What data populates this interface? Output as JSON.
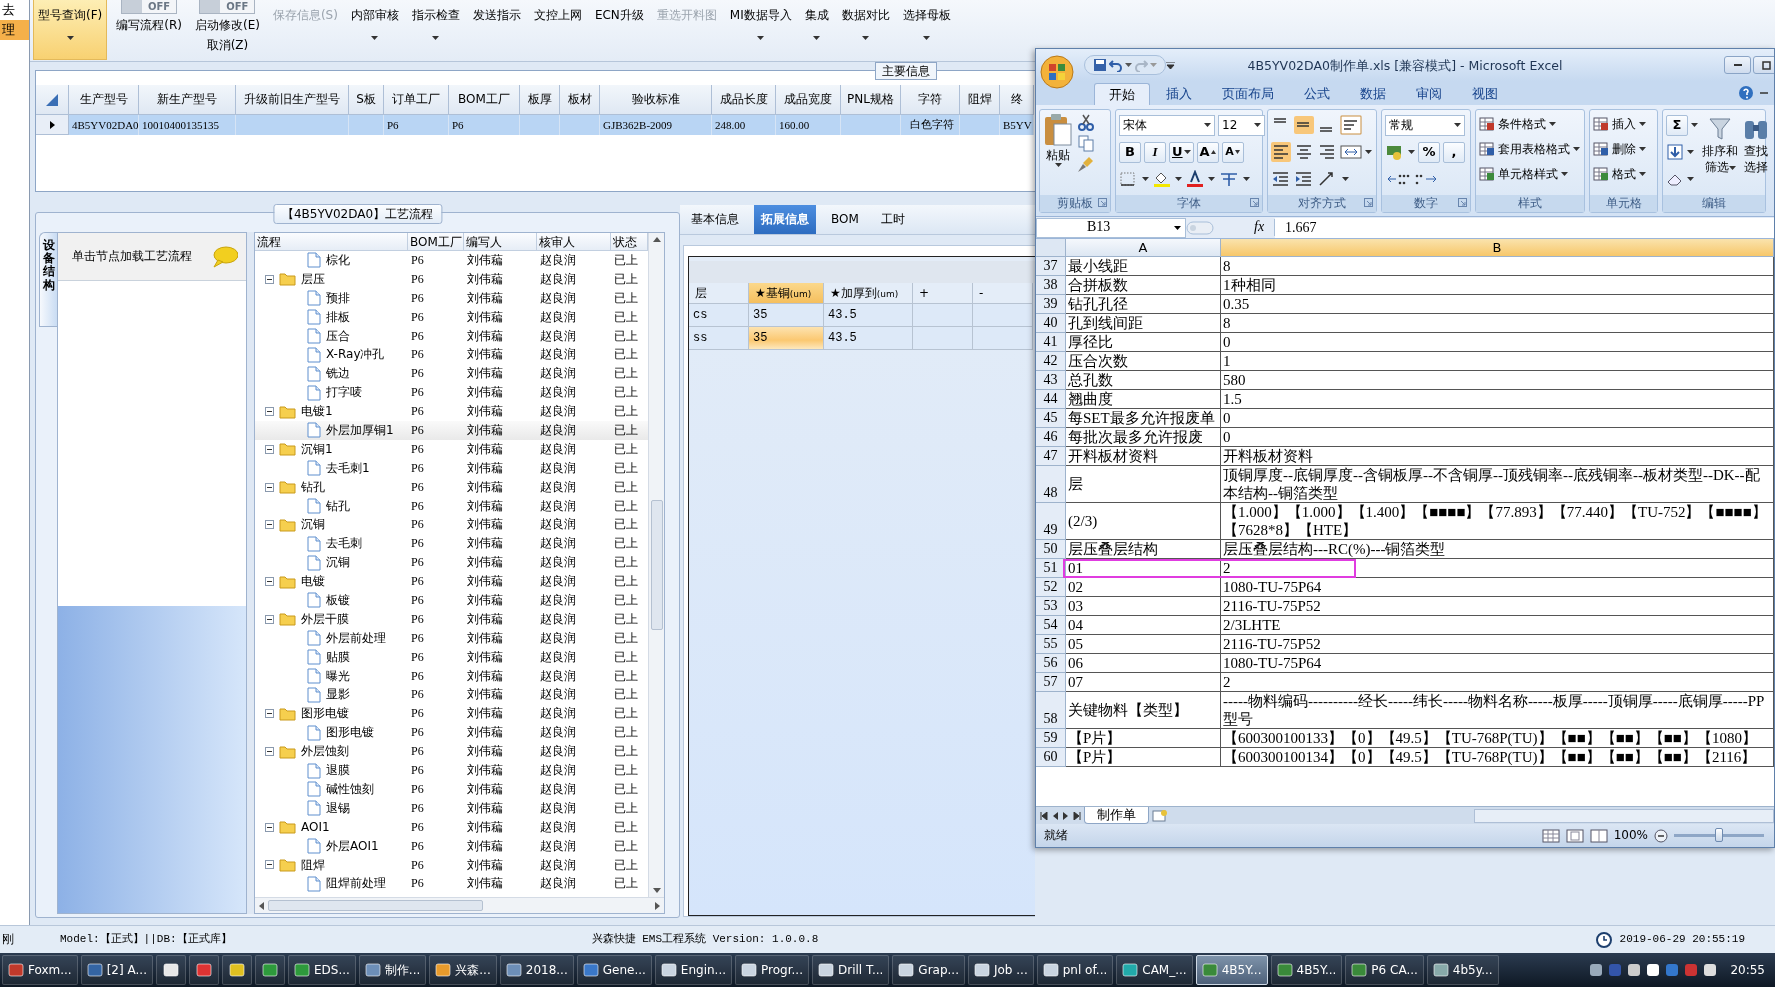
{
  "left_strip": [
    {
      "label": "去",
      "selected": false
    },
    {
      "label": "理",
      "selected": true
    }
  ],
  "toolbar": [
    {
      "kind": "button",
      "label": "型号查询(F)",
      "selected": true,
      "disabled": false,
      "dropdown": true
    },
    {
      "kind": "toggle",
      "state_text": "OFF",
      "on": false,
      "label": "编写流程(R)"
    },
    {
      "kind": "toggle",
      "state_text": "OFF",
      "on": false,
      "label": "启动修改(E)",
      "sublabel": "取消(Z)"
    },
    {
      "kind": "button",
      "label": "保存信息(S)",
      "selected": false,
      "disabled": true,
      "dropdown": false
    },
    {
      "kind": "button",
      "label": "内部审核",
      "selected": false,
      "disabled": false,
      "dropdown": true
    },
    {
      "kind": "button",
      "label": "指示检查",
      "selected": false,
      "disabled": false,
      "dropdown": true
    },
    {
      "kind": "button",
      "label": "发送指示",
      "selected": false,
      "disabled": false,
      "dropdown": false
    },
    {
      "kind": "button",
      "label": "文控上网",
      "selected": false,
      "disabled": false,
      "dropdown": false
    },
    {
      "kind": "button",
      "label": "ECN升级",
      "selected": false,
      "disabled": false,
      "dropdown": false
    },
    {
      "kind": "button",
      "label": "重选开料图",
      "selected": false,
      "disabled": true,
      "dropdown": false
    },
    {
      "kind": "button",
      "label": "MI数据导入",
      "selected": false,
      "disabled": false,
      "dropdown": true
    },
    {
      "kind": "button",
      "label": "集成",
      "selected": false,
      "disabled": false,
      "dropdown": true
    },
    {
      "kind": "button",
      "label": "数据对比",
      "selected": false,
      "disabled": false,
      "dropdown": true
    },
    {
      "kind": "button",
      "label": "选择母板",
      "selected": false,
      "disabled": false,
      "dropdown": true
    }
  ],
  "main_info": {
    "title": "主要信息",
    "columns": [
      "生产型号",
      "新生产型号",
      "升级前旧生产型号",
      "S板",
      "订单工厂",
      "BOM工厂",
      "板厚",
      "板材",
      "验收标准",
      "成品长度",
      "成品宽度",
      "PNL规格",
      "字符",
      "阻焊",
      "终"
    ],
    "rows": [
      {
        "selected": true,
        "cells": [
          "4B5YV02DA0",
          "10010400135135",
          null,
          null,
          "P6",
          "P6",
          null,
          null,
          "GJB362B-2009",
          "248.00",
          "160.00",
          null,
          "白色字符",
          null,
          "B5YV"
        ]
      }
    ]
  },
  "flow": {
    "title": "【4B5YV02DA0】工艺流程",
    "side_tab": "设备结构",
    "hint": "单击节点加载工艺流程",
    "columns": [
      "流程",
      "BOM工厂",
      "编写人",
      "核审人",
      "状态"
    ],
    "nodes": [
      {
        "children": [
          {
            "label": "棕化",
            "bom": "P6",
            "writer": "刘伟藊",
            "reviewer": "赵良润",
            "status": "已上",
            "selected": false
          }
        ]
      },
      {
        "label": "层压",
        "bom": "P6",
        "writer": "刘伟藊",
        "reviewer": "赵良润",
        "status": "已上",
        "selected": false,
        "expanded": true,
        "children": [
          {
            "label": "预排",
            "bom": "P6",
            "writer": "刘伟藊",
            "reviewer": "赵良润",
            "status": "已上",
            "selected": false
          },
          {
            "label": "排板",
            "bom": "P6",
            "writer": "刘伟藊",
            "reviewer": "赵良润",
            "status": "已上",
            "selected": false
          },
          {
            "label": "压合",
            "bom": "P6",
            "writer": "刘伟藊",
            "reviewer": "赵良润",
            "status": "已上",
            "selected": false
          },
          {
            "label": "X-Ray冲孔",
            "bom": "P6",
            "writer": "刘伟藊",
            "reviewer": "赵良润",
            "status": "已上",
            "selected": false
          },
          {
            "label": "铣边",
            "bom": "P6",
            "writer": "刘伟藊",
            "reviewer": "赵良润",
            "status": "已上",
            "selected": false
          },
          {
            "label": "打字唛",
            "bom": "P6",
            "writer": "刘伟藊",
            "reviewer": "赵良润",
            "status": "已上",
            "selected": false
          }
        ]
      },
      {
        "label": "电镀1",
        "bom": "P6",
        "writer": "刘伟藊",
        "reviewer": "赵良润",
        "status": "已上",
        "selected": false,
        "expanded": true,
        "children": [
          {
            "label": "外层加厚铜1",
            "bom": "P6",
            "writer": "刘伟藊",
            "reviewer": "赵良润",
            "status": "已上",
            "selected": true
          }
        ]
      },
      {
        "label": "沉铜1",
        "bom": "P6",
        "writer": "刘伟藊",
        "reviewer": "赵良润",
        "status": "已上",
        "selected": false,
        "expanded": true,
        "children": [
          {
            "label": "去毛刺1",
            "bom": "P6",
            "writer": "刘伟藊",
            "reviewer": "赵良润",
            "status": "已上",
            "selected": false
          }
        ]
      },
      {
        "label": "钻孔",
        "bom": "P6",
        "writer": "刘伟藊",
        "reviewer": "赵良润",
        "status": "已上",
        "selected": false,
        "expanded": true,
        "children": [
          {
            "label": "钻孔",
            "bom": "P6",
            "writer": "刘伟藊",
            "reviewer": "赵良润",
            "status": "已上",
            "selected": false
          }
        ]
      },
      {
        "label": "沉铜",
        "bom": "P6",
        "writer": "刘伟藊",
        "reviewer": "赵良润",
        "status": "已上",
        "selected": false,
        "expanded": true,
        "children": [
          {
            "label": "去毛刺",
            "bom": "P6",
            "writer": "刘伟藊",
            "reviewer": "赵良润",
            "status": "已上",
            "selected": false
          },
          {
            "label": "沉铜",
            "bom": "P6",
            "writer": "刘伟藊",
            "reviewer": "赵良润",
            "status": "已上",
            "selected": false
          }
        ]
      },
      {
        "label": "电镀",
        "bom": "P6",
        "writer": "刘伟藊",
        "reviewer": "赵良润",
        "status": "已上",
        "selected": false,
        "expanded": true,
        "children": [
          {
            "label": "板镀",
            "bom": "P6",
            "writer": "刘伟藊",
            "reviewer": "赵良润",
            "status": "已上",
            "selected": false
          }
        ]
      },
      {
        "label": "外层干膜",
        "bom": "P6",
        "writer": "刘伟藊",
        "reviewer": "赵良润",
        "status": "已上",
        "selected": false,
        "expanded": true,
        "children": [
          {
            "label": "外层前处理",
            "bom": "P6",
            "writer": "刘伟藊",
            "reviewer": "赵良润",
            "status": "已上",
            "selected": false
          },
          {
            "label": "贴膜",
            "bom": "P6",
            "writer": "刘伟藊",
            "reviewer": "赵良润",
            "status": "已上",
            "selected": false
          },
          {
            "label": "曝光",
            "bom": "P6",
            "writer": "刘伟藊",
            "reviewer": "赵良润",
            "status": "已上",
            "selected": false
          },
          {
            "label": "显影",
            "bom": "P6",
            "writer": "刘伟藊",
            "reviewer": "赵良润",
            "status": "已上",
            "selected": false
          }
        ]
      },
      {
        "label": "图形电镀",
        "bom": "P6",
        "writer": "刘伟藊",
        "reviewer": "赵良润",
        "status": "已上",
        "selected": false,
        "expanded": true,
        "children": [
          {
            "label": "图形电镀",
            "bom": "P6",
            "writer": "刘伟藊",
            "reviewer": "赵良润",
            "status": "已上",
            "selected": false
          }
        ]
      },
      {
        "label": "外层蚀刻",
        "bom": "P6",
        "writer": "刘伟藊",
        "reviewer": "赵良润",
        "status": "已上",
        "selected": false,
        "expanded": true,
        "children": [
          {
            "label": "退膜",
            "bom": "P6",
            "writer": "刘伟藊",
            "reviewer": "赵良润",
            "status": "已上",
            "selected": false
          },
          {
            "label": "碱性蚀刻",
            "bom": "P6",
            "writer": "刘伟藊",
            "reviewer": "赵良润",
            "status": "已上",
            "selected": false
          },
          {
            "label": "退锡",
            "bom": "P6",
            "writer": "刘伟藊",
            "reviewer": "赵良润",
            "status": "已上",
            "selected": false
          }
        ]
      },
      {
        "label": "AOI1",
        "bom": "P6",
        "writer": "刘伟藊",
        "reviewer": "赵良润",
        "status": "已上",
        "selected": false,
        "expanded": true,
        "children": [
          {
            "label": "外层AOI1",
            "bom": "P6",
            "writer": "刘伟藊",
            "reviewer": "赵良润",
            "status": "已上",
            "selected": false
          }
        ]
      },
      {
        "label": "阻焊",
        "bom": "P6",
        "writer": "刘伟藊",
        "reviewer": "赵良润",
        "status": "已上",
        "selected": false,
        "expanded": true,
        "children": [
          {
            "label": "阻焊前处理",
            "bom": "P6",
            "writer": "刘伟藊",
            "reviewer": "赵良润",
            "status": "已上",
            "selected": false
          }
        ]
      }
    ]
  },
  "ext": {
    "tabs": [
      {
        "label": "基本信息",
        "selected": false
      },
      {
        "label": "拓展信息",
        "selected": true
      },
      {
        "label": "BOM",
        "selected": false
      },
      {
        "label": "工时",
        "selected": false
      }
    ],
    "columns": [
      {
        "label": "层",
        "selected": false
      },
      {
        "label": "★基铜",
        "unit": "(um)",
        "selected": true
      },
      {
        "label": "★加厚到",
        "unit": "(um)",
        "selected": false
      },
      {
        "label": "+",
        "selected": false
      },
      {
        "label": "-",
        "selected": false
      }
    ],
    "rows": [
      {
        "cells": [
          "cs",
          "35",
          "43.5"
        ],
        "selected": false
      },
      {
        "cells": [
          "ss",
          "35",
          "43.5"
        ],
        "selected": true
      }
    ]
  },
  "excel": {
    "title": "4B5YV02DA0制作单.xls  [兼容模式] - Microsoft Excel",
    "tabs": [
      {
        "label": "开始",
        "selected": true
      },
      {
        "label": "插入",
        "selected": false
      },
      {
        "label": "页面布局",
        "selected": false
      },
      {
        "label": "公式",
        "selected": false
      },
      {
        "label": "数据",
        "selected": false
      },
      {
        "label": "审阅",
        "selected": false
      },
      {
        "label": "视图",
        "selected": false
      }
    ],
    "groups": [
      {
        "kind": "clipboard",
        "label": "剪贴板",
        "paste": "粘贴"
      },
      {
        "kind": "font",
        "label": "字体",
        "font": "宋体",
        "size": "12",
        "keys": [
          "B",
          "I",
          "U",
          "A",
          "A"
        ]
      },
      {
        "kind": "alignment",
        "label": "对齐方式",
        "vertical": [
          {
            "selected": false
          },
          {
            "selected": true
          },
          {
            "selected": false
          }
        ],
        "horizontal": [
          {
            "selected": true
          },
          {
            "selected": false
          },
          {
            "selected": false
          }
        ]
      },
      {
        "kind": "number",
        "label": "数字",
        "format": "常规",
        "keys": [
          "%",
          ","
        ]
      },
      {
        "kind": "styles",
        "label": "样式",
        "items": [
          "条件格式",
          "套用表格格式",
          "单元格样式"
        ]
      },
      {
        "kind": "cells",
        "label": "单元格",
        "items": [
          "插入",
          "删除",
          "格式"
        ]
      },
      {
        "kind": "editing",
        "label": "编辑",
        "sum": "Σ",
        "sort": [
          "排序和",
          "筛选"
        ],
        "find": [
          "查找",
          "选择"
        ]
      }
    ],
    "name_box": "B13",
    "fx": "fx",
    "formula": "1.667",
    "columns": [
      {
        "label": "A",
        "selected": false
      },
      {
        "label": "B",
        "selected": true
      }
    ],
    "rows": [
      {
        "num": "37",
        "a": "最小线距",
        "b": "8"
      },
      {
        "num": "38",
        "a": "合拼板数",
        "b": "1种相同"
      },
      {
        "num": "39",
        "a": "钻孔孔径",
        "b": "0.35"
      },
      {
        "num": "40",
        "a": "孔到线间距",
        "b": "8"
      },
      {
        "num": "41",
        "a": "厚径比",
        "b": "0"
      },
      {
        "num": "42",
        "a": "压合次数",
        "b": "1"
      },
      {
        "num": "43",
        "a": "总孔数",
        "b": "580"
      },
      {
        "num": "44",
        "a": "翘曲度",
        "b": "1.5"
      },
      {
        "num": "45",
        "a": "每SET最多允许报废单",
        "b": "0"
      },
      {
        "num": "46",
        "a": "每批次最多允许报废",
        "b": "0"
      },
      {
        "num": "47",
        "a": "开料板材资料",
        "b": "开料板材资料"
      },
      {
        "num": "48",
        "a": "层",
        "b": "顶铜厚度--底铜厚度--含铜板厚--不含铜厚--顶残铜率--底残铜率--板材类型--DK--配本结构--铜箔类型"
      },
      {
        "num": "49",
        "a": "(2/3)",
        "b": "【1.000】【1.000】【1.400】【■■■■】【77.893】【77.440】【TU-752】【■■■■】【7628*8】【HTE】"
      },
      {
        "num": "50",
        "a": "层压叠层结构",
        "b": "层压叠层结构---RC(%)---铜箔类型"
      },
      {
        "num": "51",
        "a": "01",
        "b": "2",
        "outlined": true
      },
      {
        "num": "52",
        "a": "02",
        "b": "1080-TU-75P64"
      },
      {
        "num": "53",
        "a": "03",
        "b": "2116-TU-75P52"
      },
      {
        "num": "54",
        "a": "04",
        "b": "2/3LHTE"
      },
      {
        "num": "55",
        "a": "05",
        "b": "2116-TU-75P52"
      },
      {
        "num": "56",
        "a": "06",
        "b": "1080-TU-75P64"
      },
      {
        "num": "57",
        "a": "07",
        "b": "2"
      },
      {
        "num": "58",
        "a": "关键物料【类型】",
        "b": "-----物料编码----------经长-----纬长-----物料名称-----板厚-----顶铜厚-----底铜厚-----PP型号"
      },
      {
        "num": "59",
        "a": "【P片】",
        "b": "【600300100133】【0】【49.5】【TU-768P(TU)】【■■】【■■】【■■】【1080】"
      },
      {
        "num": "60",
        "a": "【P片】",
        "b": "【600300100134】【0】【49.5】【TU-768P(TU)】【■■】【■■】【■■】【2116】"
      }
    ],
    "sheets": [
      {
        "label": "制作单",
        "selected": true
      }
    ],
    "status": "就绪",
    "zoom": {
      "reading": "100%",
      "level": 0.5
    }
  },
  "status_bar": {
    "left": "刚",
    "model": "Model:【正式】||DB:【正式库】",
    "center": "兴森快捷 EMS工程系统 Version: 1.0.0.8",
    "datetime": "2019-06-29 20:55:19"
  },
  "taskbar": {
    "items": [
      {
        "kind": "app",
        "label": "Foxm...",
        "selected": false
      },
      {
        "kind": "app",
        "label": "[2] A...",
        "selected": false
      },
      {
        "kind": "launcher",
        "selected": false
      },
      {
        "kind": "launcher",
        "selected": false
      },
      {
        "kind": "launcher",
        "selected": false
      },
      {
        "kind": "launcher",
        "selected": false
      },
      {
        "kind": "app",
        "label": "EDS...",
        "selected": false
      },
      {
        "kind": "app",
        "label": "制作...",
        "selected": false
      },
      {
        "kind": "app",
        "label": "兴森...",
        "selected": false
      },
      {
        "kind": "app",
        "label": "2018...",
        "selected": false
      },
      {
        "kind": "app",
        "label": "Gene...",
        "selected": false
      },
      {
        "kind": "app",
        "label": "Engin...",
        "selected": false
      },
      {
        "kind": "app",
        "label": "Progr...",
        "selected": false
      },
      {
        "kind": "app",
        "label": "Drill T...",
        "selected": false
      },
      {
        "kind": "app",
        "label": "Grap...",
        "selected": false
      },
      {
        "kind": "app",
        "label": "Job ...",
        "selected": false
      },
      {
        "kind": "app",
        "label": "pnl of...",
        "selected": false
      },
      {
        "kind": "app",
        "label": "CAM_...",
        "selected": false
      },
      {
        "kind": "app",
        "label": "4B5Y...",
        "selected": true
      },
      {
        "kind": "app",
        "label": "4B5Y...",
        "selected": false
      },
      {
        "kind": "app",
        "label": "P6 CA...",
        "selected": false
      },
      {
        "kind": "app",
        "label": "4b5y...",
        "selected": false
      }
    ],
    "clock": "20:55"
  }
}
